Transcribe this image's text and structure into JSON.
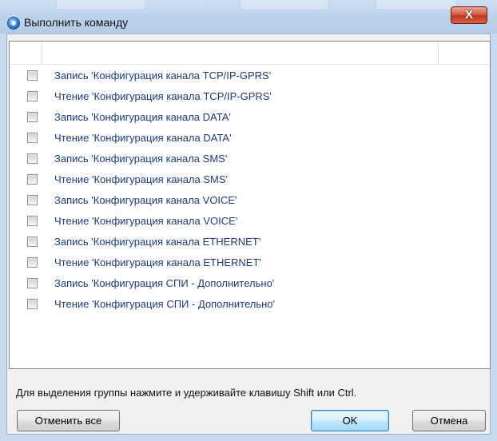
{
  "window": {
    "title": "Выполнить команду",
    "close_label": "X"
  },
  "list": {
    "items": [
      {
        "label": "Запись 'Конфигурация канала TCP/IP-GPRS'",
        "checked": false
      },
      {
        "label": "Чтение 'Конфигурация канала TCP/IP-GPRS'",
        "checked": false
      },
      {
        "label": "Запись 'Конфигурация канала DATA'",
        "checked": false
      },
      {
        "label": "Чтение 'Конфигурация канала DATA'",
        "checked": false
      },
      {
        "label": "Запись 'Конфигурация канала SMS'",
        "checked": false
      },
      {
        "label": "Чтение 'Конфигурация канала SMS'",
        "checked": false
      },
      {
        "label": "Запись 'Конфигурация канала VOICE'",
        "checked": false
      },
      {
        "label": "Чтение 'Конфигурация канала VOICE'",
        "checked": false
      },
      {
        "label": "Запись 'Конфигурация канала ETHERNET'",
        "checked": false
      },
      {
        "label": "Чтение 'Конфигурация канала ETHERNET'",
        "checked": false
      },
      {
        "label": "Запись 'Конфигурация СПИ - Дополнительно'",
        "checked": false
      },
      {
        "label": "Чтение 'Конфигурация СПИ - Дополнительно'",
        "checked": false
      }
    ]
  },
  "hint": "Для выделения группы нажмите и удерживайте клавишу Shift или Ctrl.",
  "buttons": {
    "deselect_all": "Отменить все",
    "ok": "OK",
    "cancel": "Отмена"
  },
  "colors": {
    "item_text": "#1b3a82",
    "close_button": "#c2361c"
  }
}
